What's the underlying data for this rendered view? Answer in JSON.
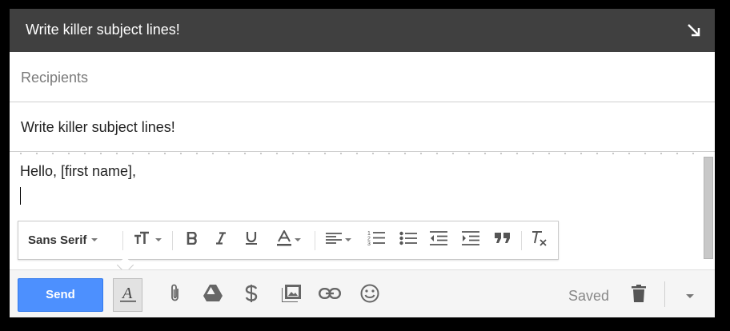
{
  "window": {
    "title": "Write killer subject lines!"
  },
  "recipients": {
    "placeholder": "Recipients"
  },
  "subject": {
    "value": "Write killer subject lines!"
  },
  "body": {
    "text": "Hello, [first name],"
  },
  "formatting_toolbar": {
    "font_family": "Sans Serif",
    "icons": [
      "text-size-icon",
      "bold-icon",
      "italic-icon",
      "underline-icon",
      "text-color-icon",
      "align-icon",
      "numbered-list-icon",
      "bulleted-list-icon",
      "indent-less-icon",
      "indent-more-icon",
      "quote-icon",
      "remove-formatting-icon"
    ]
  },
  "bottom_bar": {
    "send_label": "Send",
    "status": "Saved",
    "icons": [
      "formatting-options-icon",
      "attach-file-icon",
      "google-drive-icon",
      "send-money-icon",
      "insert-photo-icon",
      "insert-link-icon",
      "insert-emoji-icon",
      "trash-icon",
      "more-options-icon"
    ]
  },
  "colors": {
    "title_bar": "#404040",
    "send_button": "#4d90fe",
    "bottom_bar": "#f5f5f5"
  }
}
